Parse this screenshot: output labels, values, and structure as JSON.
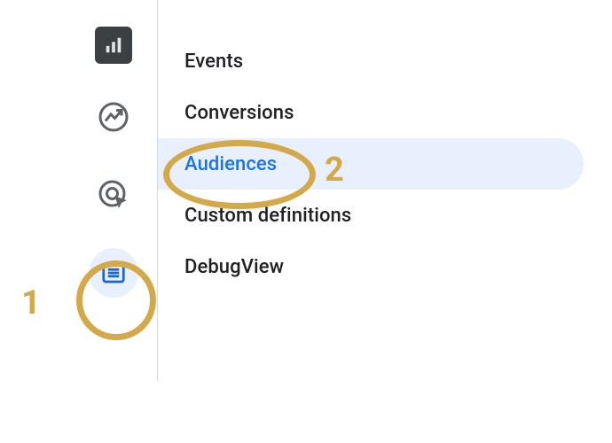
{
  "rail": {
    "items": [
      {
        "name": "reports-icon",
        "icon": "bars",
        "selected": false,
        "dark": true
      },
      {
        "name": "realtime-icon",
        "icon": "trend-circle",
        "selected": false,
        "dark": false
      },
      {
        "name": "explore-icon",
        "icon": "target-click",
        "selected": false,
        "dark": false
      },
      {
        "name": "configure-icon",
        "icon": "list",
        "selected": true,
        "dark": false
      }
    ]
  },
  "menu": {
    "items": [
      {
        "label": "Events",
        "selected": false
      },
      {
        "label": "Conversions",
        "selected": false
      },
      {
        "label": "Audiences",
        "selected": true
      },
      {
        "label": "Custom definitions",
        "selected": false
      },
      {
        "label": "DebugView",
        "selected": false
      }
    ]
  },
  "annotations": {
    "one": "1",
    "two": "2"
  },
  "colors": {
    "accent": "#1a73e8",
    "annotation": "#d4a94a"
  }
}
